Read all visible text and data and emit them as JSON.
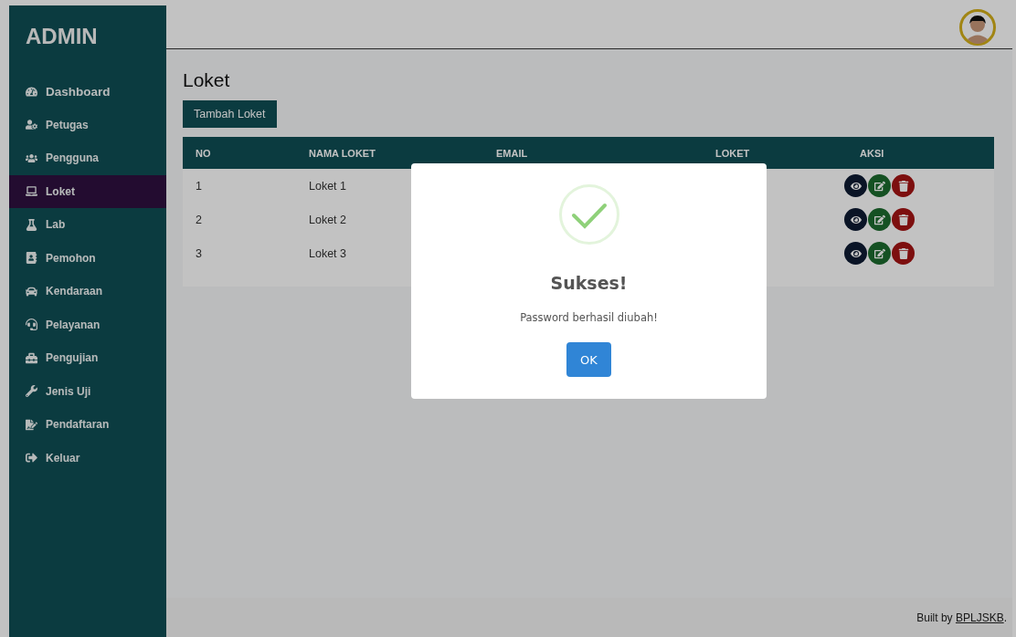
{
  "sidebar": {
    "brand": "ADMIN",
    "items": [
      {
        "label": "Dashboard",
        "selected": false
      },
      {
        "label": "Petugas",
        "selected": false
      },
      {
        "label": "Pengguna",
        "selected": false
      },
      {
        "label": "Loket",
        "selected": true
      },
      {
        "label": "Lab",
        "selected": false
      },
      {
        "label": "Pemohon",
        "selected": false
      },
      {
        "label": "Kendaraan",
        "selected": false
      },
      {
        "label": "Pelayanan",
        "selected": false
      },
      {
        "label": "Pengujian",
        "selected": false
      },
      {
        "label": "Jenis Uji",
        "selected": false
      },
      {
        "label": "Pendaftaran",
        "selected": false
      },
      {
        "label": "Keluar",
        "selected": false
      }
    ]
  },
  "page": {
    "title": "Loket",
    "add_button": "Tambah Loket"
  },
  "table": {
    "columns": [
      "NO",
      "NAMA LOKET",
      "EMAIL",
      "LOKET",
      "AKSI"
    ],
    "rows": [
      {
        "cells": [
          "1",
          "Loket 1"
        ]
      },
      {
        "cells": [
          "2",
          "Loket 2"
        ]
      },
      {
        "cells": [
          "3",
          "Loket 3"
        ]
      }
    ]
  },
  "footer": {
    "text": "Built by",
    "link": "BPLJSKB",
    "suffix": "."
  },
  "dialog": {
    "title": "Sukses!",
    "message": "Password berhasil diubah!",
    "button": "OK"
  }
}
